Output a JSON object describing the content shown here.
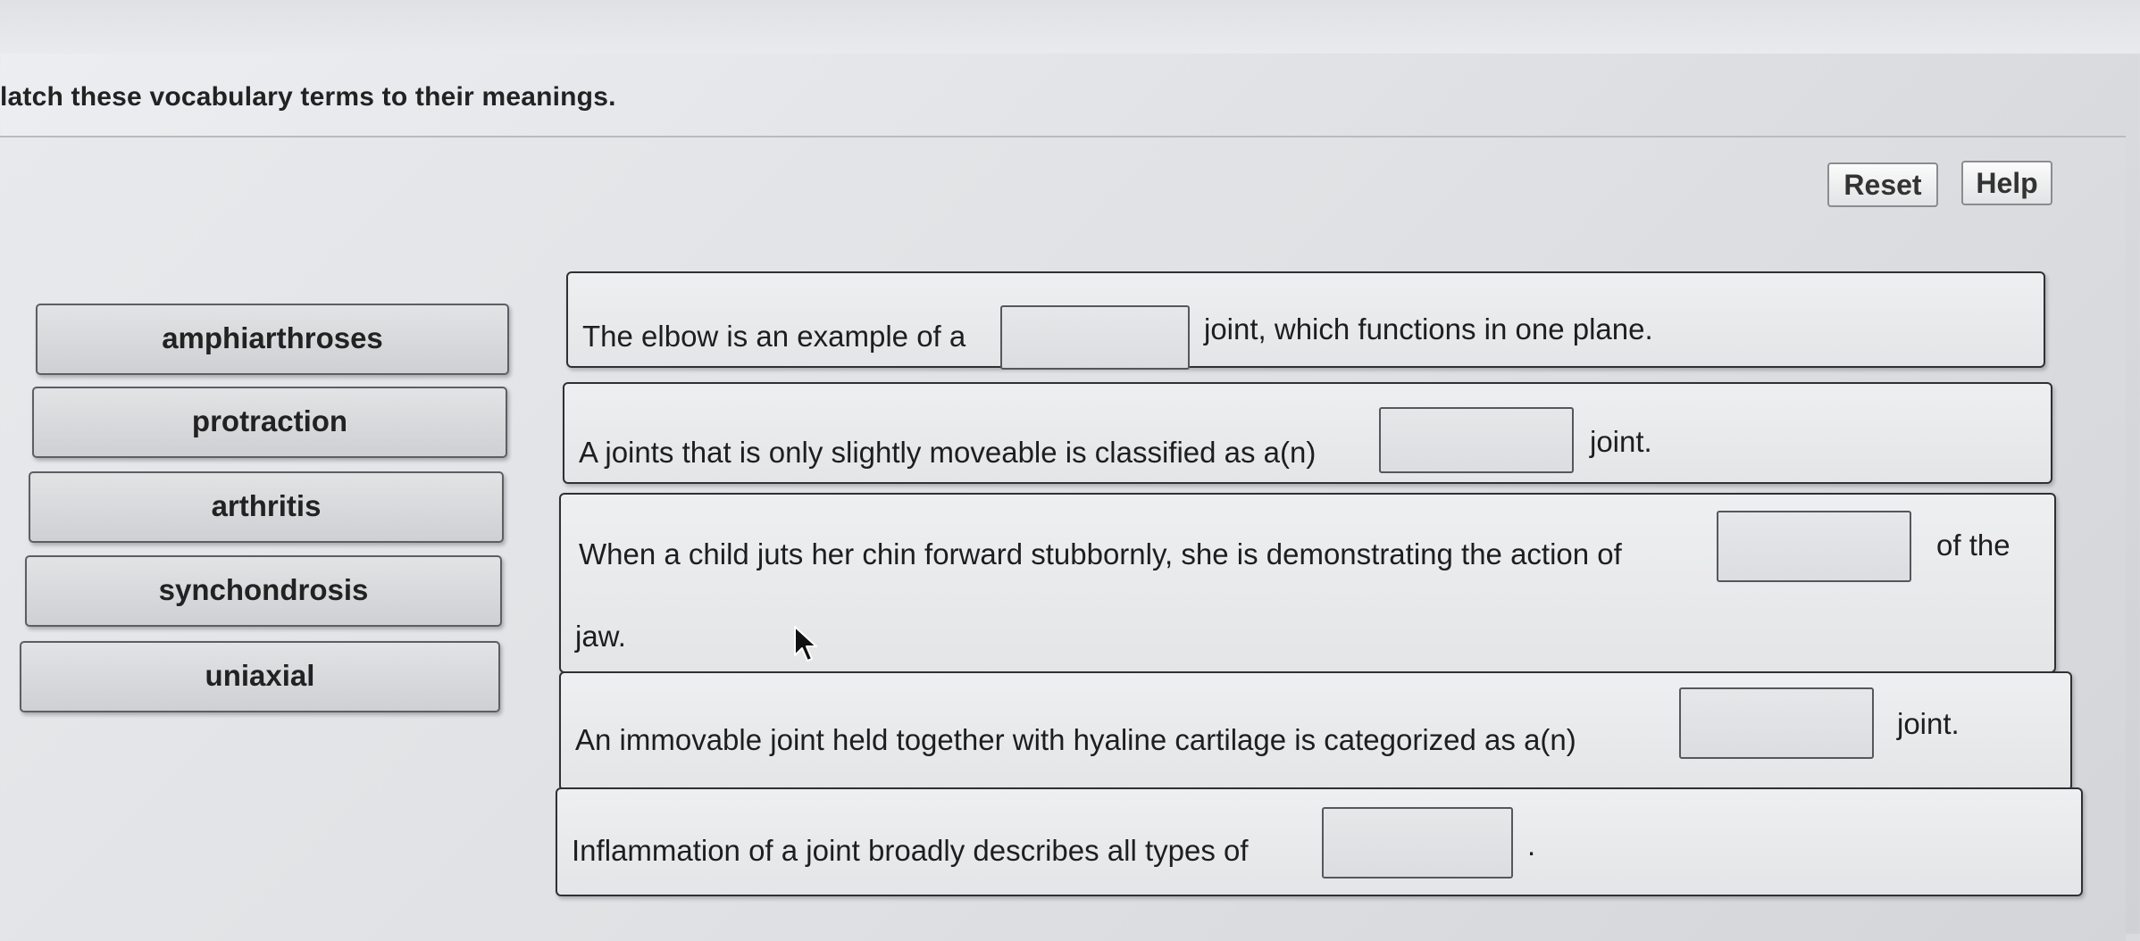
{
  "instruction": "latch these vocabulary terms to their meanings.",
  "buttons": {
    "reset": "Reset",
    "help": "Help"
  },
  "terms": [
    "amphiarthroses",
    "protraction",
    "arthritis",
    "synchondrosis",
    "uniaxial"
  ],
  "questions": [
    {
      "before": "The elbow is an example of a",
      "after": "joint, which functions in one plane."
    },
    {
      "before": "A joints that is only slightly moveable is classified as a(n)",
      "after": "joint."
    },
    {
      "before": "When a child juts her chin forward stubbornly, she is demonstrating the action of",
      "after": "of the",
      "continuation": "jaw."
    },
    {
      "before": "An immovable joint held together with hyaline cartilage is categorized as a(n)",
      "after": "joint."
    },
    {
      "before": "Inflammation of a joint broadly describes all types of",
      "after": "."
    }
  ],
  "icons": {
    "cursor": "mouse-pointer-icon"
  }
}
